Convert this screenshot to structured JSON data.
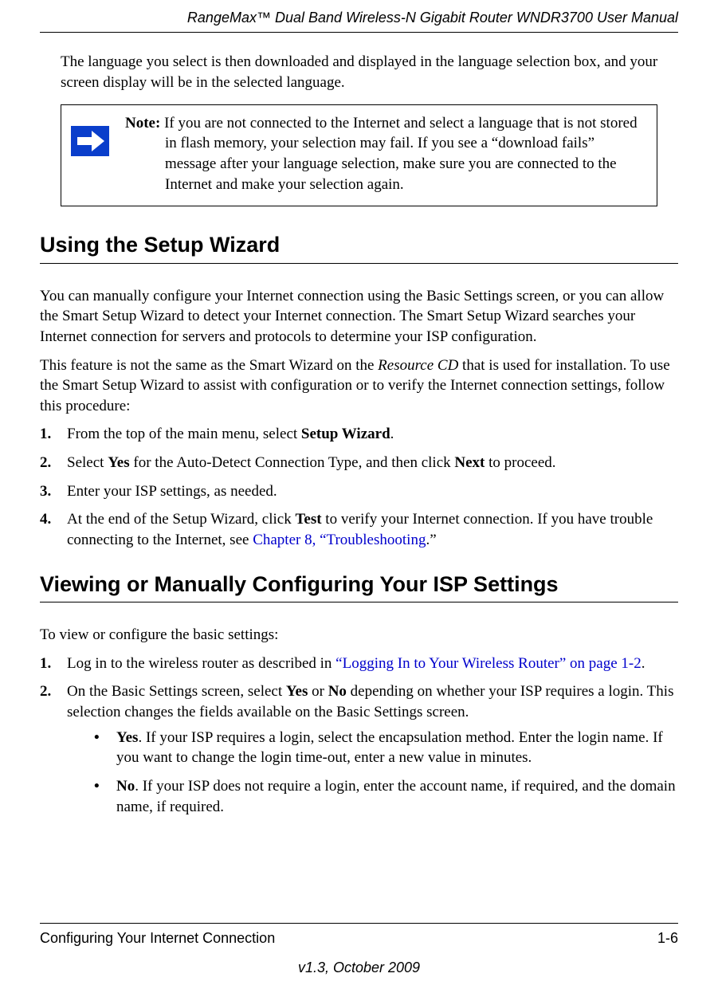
{
  "header": {
    "title": "RangeMax™ Dual Band Wireless-N Gigabit Router WNDR3700 User Manual"
  },
  "intro": {
    "para1": "The language you select is then downloaded and displayed in the language selection box, and your screen display will be in the selected language."
  },
  "note": {
    "label": "Note:",
    "body": " If you are not connected to the Internet and select a language that is not stored in flash memory, your selection may fail. If you see a “download fails” message after your language selection, make sure you are connected to the Internet and make your selection again."
  },
  "section1": {
    "title": "Using the Setup Wizard",
    "para1": "You can manually configure your Internet connection using the Basic Settings screen, or you can allow the Smart Setup Wizard to detect your Internet connection. The Smart Setup Wizard searches your Internet connection for servers and protocols to determine your ISP configuration.",
    "para2_a": "This feature is not the same as the Smart Wizard on the ",
    "para2_em": "Resource CD",
    "para2_b": " that is used for installation. To use the Smart Setup Wizard to assist with configuration or to verify the Internet connection settings, follow this procedure:",
    "steps": {
      "s1": {
        "num": "1.",
        "a": "From the top of the main menu, select ",
        "b1": "Setup Wizard",
        "b": "."
      },
      "s2": {
        "num": "2.",
        "a": "Select ",
        "b1": "Yes",
        "b": " for the Auto-Detect Connection Type, and then click ",
        "b2": "Next",
        "c": " to proceed."
      },
      "s3": {
        "num": "3.",
        "a": "Enter your ISP settings, as needed."
      },
      "s4": {
        "num": "4.",
        "a": "At the end of the Setup Wizard, click ",
        "b1": "Test",
        "b": " to verify your Internet connection. If you have trouble connecting to the Internet, see ",
        "link": "Chapter 8, “Troubleshooting",
        "c": ".”"
      }
    }
  },
  "section2": {
    "title": "Viewing or Manually Configuring Your ISP Settings",
    "para1": "To view or configure the basic settings:",
    "steps": {
      "s1": {
        "num": "1.",
        "a": "Log in to the wireless router as described in ",
        "link": "“Logging In to Your Wireless Router” on page 1-2",
        "b": "."
      },
      "s2": {
        "num": "2.",
        "a": "On the Basic Settings screen, select ",
        "b1": "Yes",
        "b": " or ",
        "b2": "No",
        "c": " depending on whether your ISP requires a login. This selection changes the fields available on the Basic Settings screen."
      }
    },
    "bullets": {
      "yes": {
        "b1": "Yes",
        "a": ". If your ISP requires a login, select the encapsulation method. Enter the login name. If you want to change the login time-out, enter a new value in minutes."
      },
      "no": {
        "b1": "No",
        "a": ". If your ISP does not require a login, enter the account name, if required, and the domain name, if required."
      }
    }
  },
  "footer": {
    "left": "Configuring Your Internet Connection",
    "right": "1-6",
    "version": "v1.3, October 2009"
  }
}
